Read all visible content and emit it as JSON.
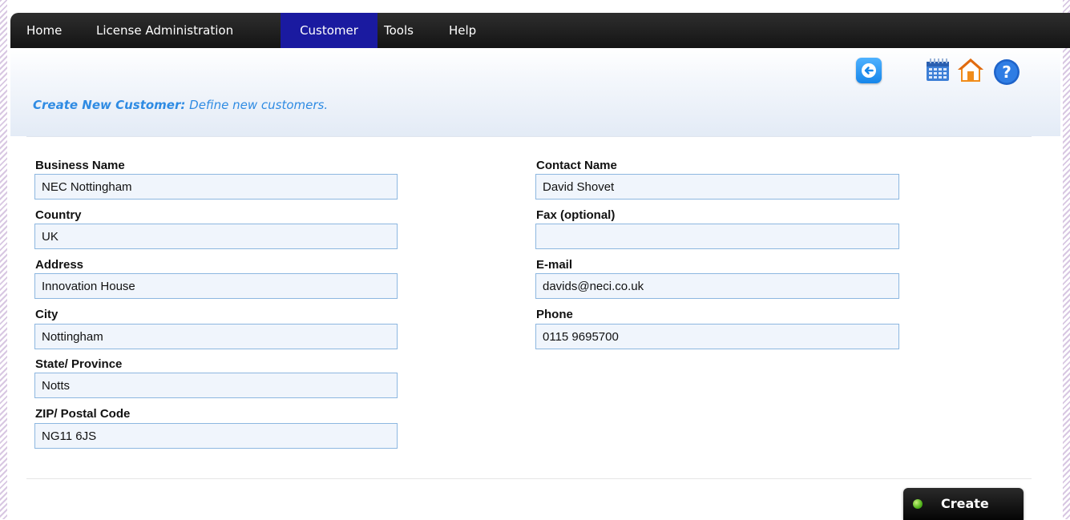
{
  "nav": {
    "items": [
      {
        "label": "Home"
      },
      {
        "label": "License Administration"
      },
      {
        "label": "Customer"
      },
      {
        "label": "Tools"
      },
      {
        "label": "Help"
      }
    ],
    "active": "Customer"
  },
  "header": {
    "title_bold": "Create New Customer:",
    "title_desc": "Define new customers.",
    "icons": [
      "back-arrow-icon",
      "calendar-icon",
      "home-icon",
      "help-icon"
    ]
  },
  "form": {
    "business_name": {
      "label": "Business Name",
      "value": "NEC Nottingham"
    },
    "country": {
      "label": "Country",
      "value": "UK"
    },
    "address": {
      "label": "Address",
      "value": "Innovation House"
    },
    "city": {
      "label": "City",
      "value": "Nottingham"
    },
    "state": {
      "label": "State/ Province",
      "value": "Notts"
    },
    "zip": {
      "label": "ZIP/ Postal Code",
      "value": "NG11 6JS"
    },
    "contact_name": {
      "label": "Contact Name",
      "value": "David Shovet"
    },
    "fax": {
      "label": "Fax (optional)",
      "value": ""
    },
    "email": {
      "label": "E-mail",
      "value": "davids@neci.co.uk"
    },
    "phone": {
      "label": "Phone",
      "value": "0115 9695700"
    }
  },
  "actions": {
    "create_label": "Create"
  },
  "colors": {
    "accent": "#2f8be3",
    "active_nav": "#1a1aa0",
    "input_border": "#8db7e0"
  }
}
